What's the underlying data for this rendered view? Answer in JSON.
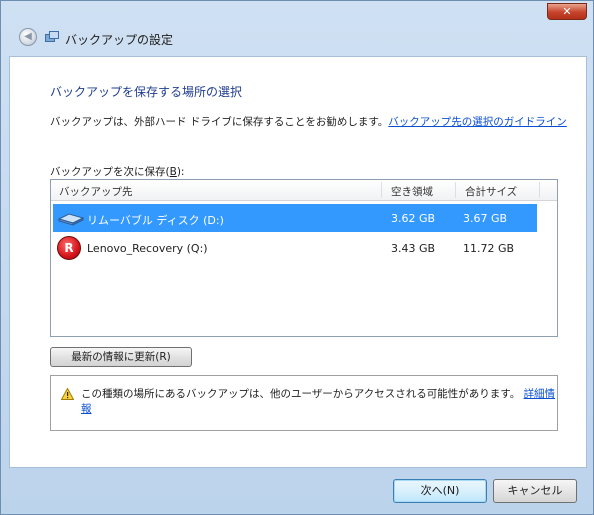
{
  "window": {
    "title": "バックアップの設定",
    "close_label": "✕"
  },
  "main": {
    "heading": "バックアップを保存する場所の選択",
    "intro_text": "バックアップは、外部ハード ドライブに保存することをお勧めします。",
    "intro_link": "バックアップ先の選択のガイドライン",
    "list_label_prefix": "バックアップを次に保存(",
    "list_label_accel": "B",
    "list_label_suffix": "):"
  },
  "table": {
    "columns": [
      "バックアップ先",
      "空き領域",
      "合計サイズ"
    ],
    "rows": [
      {
        "icon": "removable-disk-icon",
        "name": "リムーバブル ディスク (D:)",
        "free": "3.62 GB",
        "total": "3.67 GB",
        "selected": true
      },
      {
        "icon": "recovery-drive-icon",
        "name": "Lenovo_Recovery (Q:)",
        "free": "3.43 GB",
        "total": "11.72 GB",
        "selected": false
      }
    ]
  },
  "refresh_button": "最新の情報に更新(R)",
  "warning": {
    "text": "この種類の場所にあるバックアップは、他のユーザーからアクセスされる可能性があります。",
    "link": "詳細情報"
  },
  "buttons": {
    "next": "次へ(N)",
    "cancel": "キャンセル"
  },
  "colors": {
    "selection": "#3399ff",
    "heading": "#1f3c8f",
    "link": "#0b4fd1"
  }
}
